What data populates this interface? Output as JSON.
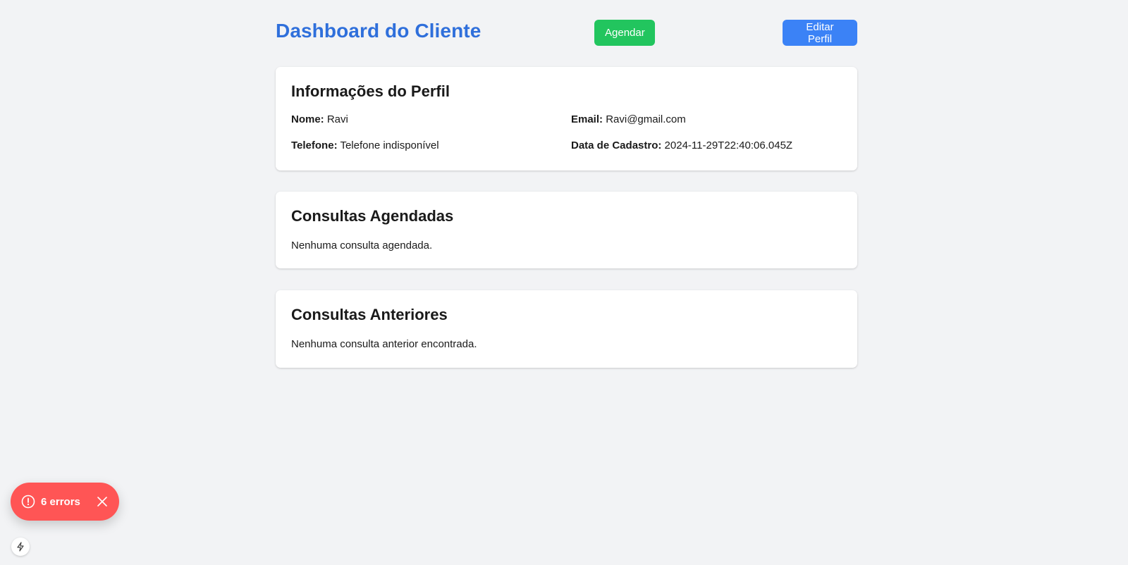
{
  "header": {
    "title": "Dashboard do Cliente",
    "schedule_label": "Agendar",
    "edit_label": "Editar Perfil"
  },
  "profile": {
    "heading": "Informações do Perfil",
    "name_label": "Nome:",
    "name_value": "Ravi",
    "email_label": "Email:",
    "email_value": "Ravi@gmail.com",
    "phone_label": "Telefone:",
    "phone_value": "Telefone indisponível",
    "date_label": "Data de Cadastro:",
    "date_value": "2024-11-29T22:40:06.045Z"
  },
  "upcoming": {
    "heading": "Consultas Agendadas",
    "empty": "Nenhuma consulta agendada."
  },
  "past": {
    "heading": "Consultas Anteriores",
    "empty": "Nenhuma consulta anterior encontrada."
  },
  "errors": {
    "label": "6 errors"
  },
  "colors": {
    "title": "#2f6fdb",
    "schedule_button": "#22c55e",
    "edit_button": "#3b82f6",
    "error_pill": "#ff5555"
  }
}
